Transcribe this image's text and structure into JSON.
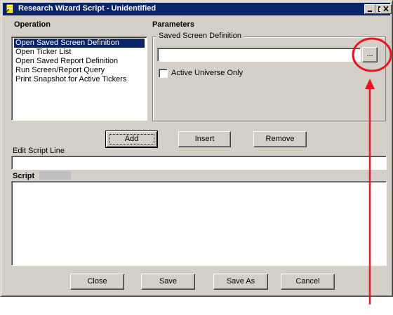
{
  "window": {
    "title": "Research Wizard Script - Unidentified",
    "controls": {
      "minimize": "minimize-icon",
      "maximize": "maximize-icon",
      "close": "close-icon"
    }
  },
  "operation": {
    "heading": "Operation",
    "items": [
      {
        "label": "Open Saved Screen Definition",
        "selected": true
      },
      {
        "label": "Open Ticker List",
        "selected": false
      },
      {
        "label": "Open Saved Report Definition",
        "selected": false
      },
      {
        "label": "Run Screen/Report Query",
        "selected": false
      },
      {
        "label": "Print Snapshot for Active Tickers",
        "selected": false
      }
    ]
  },
  "parameters": {
    "heading": "Parameters",
    "group_label": "Saved Screen Definition",
    "definition_value": "",
    "browse_label": "...",
    "active_universe_label": "Active Universe Only",
    "active_universe_checked": false
  },
  "actions": {
    "add": "Add",
    "insert": "Insert",
    "remove": "Remove"
  },
  "edit_line": {
    "label": "Edit Script Line",
    "value": ""
  },
  "script": {
    "label": "Script"
  },
  "footer": {
    "close": "Close",
    "save": "Save",
    "save_as": "Save As",
    "cancel": "Cancel"
  },
  "annotation": {
    "highlight_color": "#e8131d"
  },
  "colors": {
    "titlebar": "#0a246a",
    "face": "#d4d0c8",
    "selection": "#0a246a"
  }
}
